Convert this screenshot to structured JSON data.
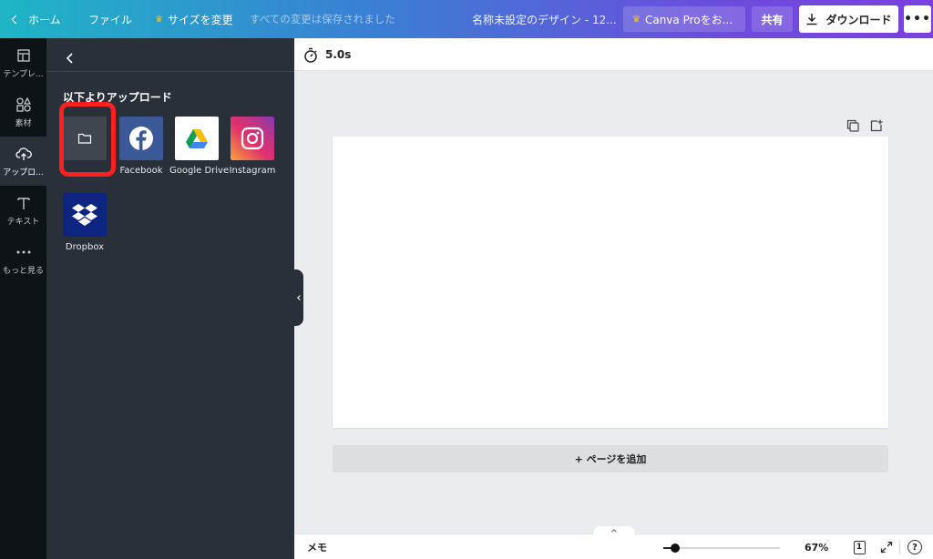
{
  "topbar": {
    "home_label": "ホーム",
    "file_label": "ファイル",
    "resize_label": "サイズを変更",
    "saved_status": "すべての変更は保存されました",
    "design_title": "名称未設定のデザイン - 12...",
    "pro_label": "Canva Proをお...",
    "share_label": "共有",
    "download_label": "ダウンロード",
    "more_label": "•••"
  },
  "rail": {
    "items": [
      {
        "label": "テンプレ...",
        "icon": "template-icon"
      },
      {
        "label": "素材",
        "icon": "elements-icon"
      },
      {
        "label": "アップロ...",
        "icon": "upload-icon"
      },
      {
        "label": "テキスト",
        "icon": "text-icon"
      },
      {
        "label": "もっと見る",
        "icon": "more-icon"
      }
    ],
    "active": "アップロ..."
  },
  "panel": {
    "heading": "以下よりアップロード",
    "sources": [
      {
        "label": "",
        "icon": "folder-icon"
      },
      {
        "label": "Facebook",
        "icon": "facebook-icon",
        "color": "#3b5998"
      },
      {
        "label": "Google Drive",
        "icon": "google-drive-icon"
      },
      {
        "label": "Instagram",
        "icon": "instagram-icon"
      },
      {
        "label": "Dropbox",
        "icon": "dropbox-icon",
        "color": "#0d2481"
      }
    ]
  },
  "editor": {
    "duration": "5.0s",
    "add_page_label": "+ ページを追加"
  },
  "bottombar": {
    "memo_label": "メモ",
    "zoom_label": "67%",
    "zoom_value": 0.1,
    "page_count": "1",
    "help_label": "?"
  },
  "colors": {
    "highlight": "#ff1f1f",
    "panel_bg": "#293039",
    "rail_bg": "#0e1318"
  }
}
